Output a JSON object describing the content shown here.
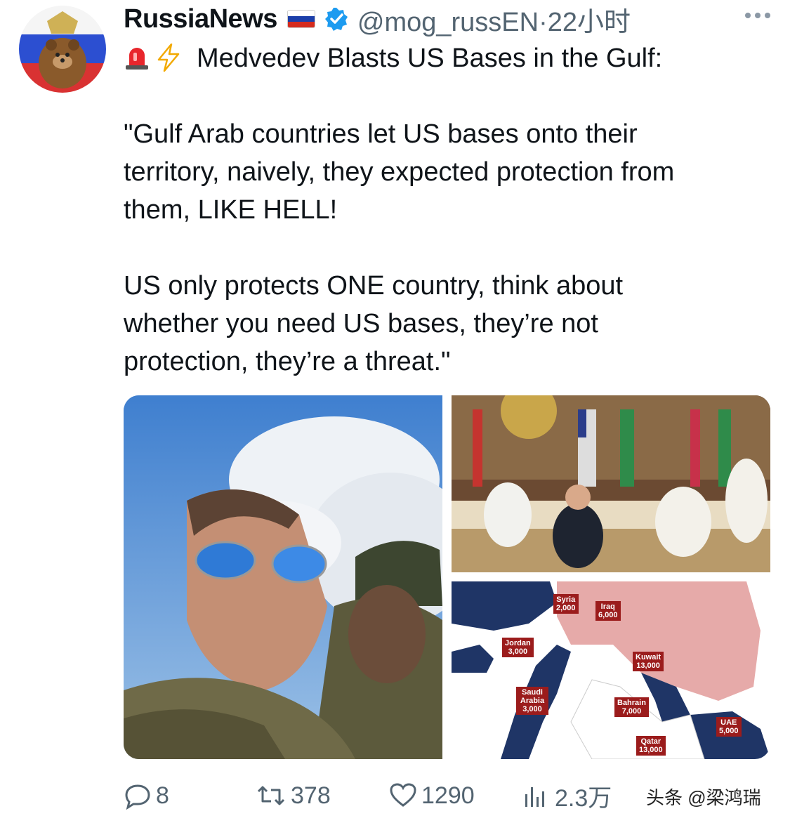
{
  "author": {
    "display_name": "RussiaNews",
    "handle_time": "@mog_russEN·22小时",
    "flag_colors": [
      "#ffffff",
      "#1c3faa",
      "#d52b1e"
    ],
    "verified_color": "#1d9bf0"
  },
  "tweet": {
    "lines": [
      "Medvedev Blasts US Bases in the Gulf:",
      "\"Gulf Arab countries let US bases onto their",
      "territory, naively, they expected protection from",
      "them, LIKE HELL!",
      "US only protects ONE country, think about",
      "whether you need US bases, they’re not",
      "protection, they’re a threat.\""
    ]
  },
  "map": {
    "labels": [
      {
        "id": "syria",
        "name": "Syria",
        "value": "2,000"
      },
      {
        "id": "iraq",
        "name": "Iraq",
        "value": "6,000"
      },
      {
        "id": "jordan",
        "name": "Jordan",
        "value": "3,000"
      },
      {
        "id": "kuwait",
        "name": "Kuwait",
        "value": "13,000"
      },
      {
        "id": "saudi",
        "name": "Saudi Arabia",
        "value": "3,000"
      },
      {
        "id": "bahrain",
        "name": "Bahrain",
        "value": "7,000"
      },
      {
        "id": "uae",
        "name": "UAE",
        "value": "5,000"
      },
      {
        "id": "qatar",
        "name": "Qatar",
        "value": "13,000"
      }
    ]
  },
  "actions": {
    "replies": "8",
    "reposts": "378",
    "likes": "1290",
    "views": "2.3万"
  },
  "watermark": "头条 @梁鸿瑞",
  "colors": {
    "text_primary": "#0f1419",
    "text_secondary": "#536471",
    "map_land_highlight": "#e6aaa9",
    "map_sea": "#1f3566",
    "map_label_bg": "#9b1c1c"
  }
}
